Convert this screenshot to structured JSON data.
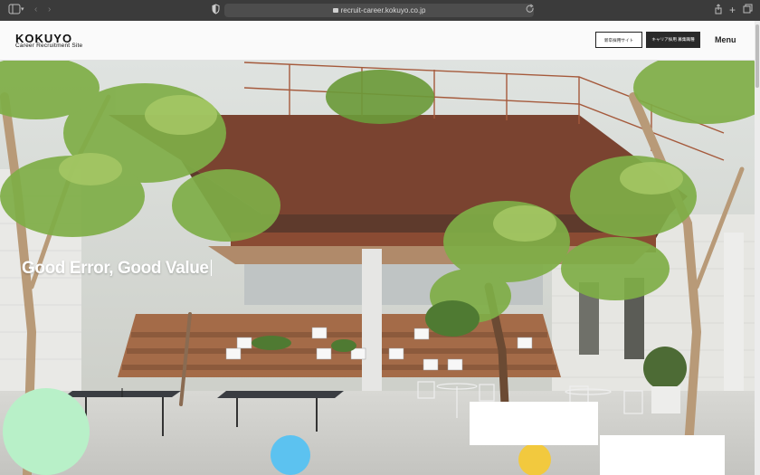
{
  "browser": {
    "url": "recruit-career.kokuyo.co.jp"
  },
  "header": {
    "logo": "KOKUYO",
    "logo_subtitle": "Career Recruitment Site",
    "newgrad_button": "新卒採用サイト",
    "career_button": "キャリア採用 募集職種",
    "menu_label": "Menu"
  },
  "hero": {
    "headline": "Good Error, Good Value"
  },
  "colors": {
    "mint_circle": "#b8f0c8",
    "blue_circle": "#5cc2f0",
    "yellow_circle": "#f2c93e",
    "beam": "#8a4b33"
  },
  "icons": [
    "sidebar-icon",
    "back-icon",
    "forward-icon",
    "shield-icon",
    "lock-icon",
    "reload-icon",
    "share-icon",
    "new-tab-icon",
    "tabs-icon"
  ]
}
